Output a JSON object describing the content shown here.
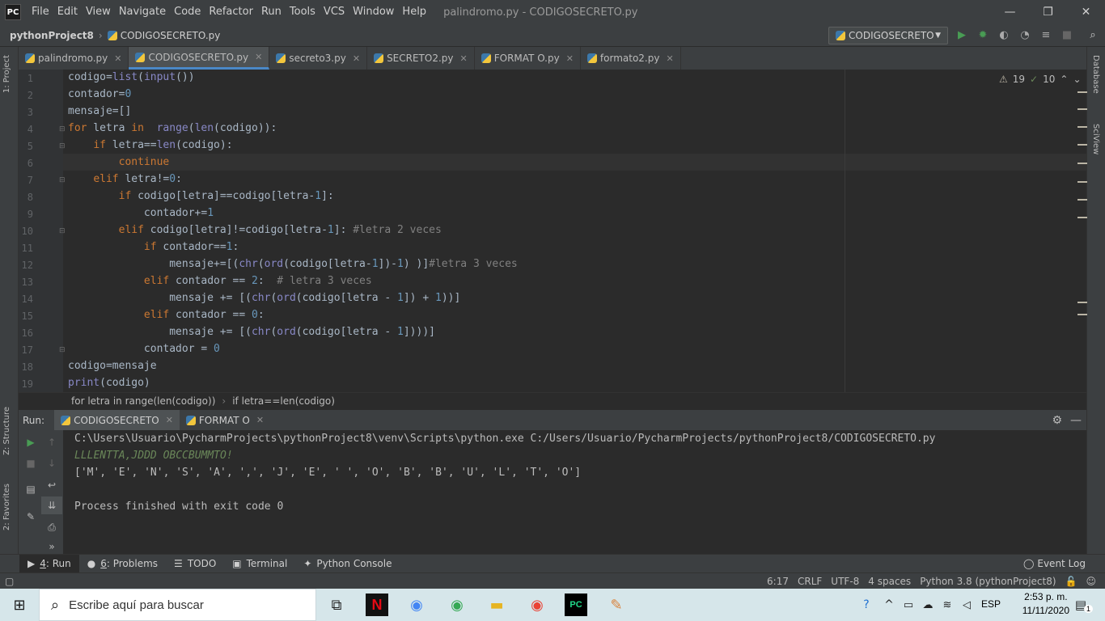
{
  "window": {
    "title": "palindromo.py - CODIGOSECRETO.py",
    "min": "—",
    "max": "❐",
    "close": "✕"
  },
  "menu": [
    "File",
    "Edit",
    "View",
    "Navigate",
    "Code",
    "Refactor",
    "Run",
    "Tools",
    "VCS",
    "Window",
    "Help"
  ],
  "nav": {
    "project": "pythonProject8",
    "file": "CODIGOSECRETO.py",
    "run_config": "CODIGOSECRETO"
  },
  "tabs": [
    "palindromo.py",
    "CODIGOSECRETO.py",
    "secreto3.py",
    "SECRETO2.py",
    "FORMAT O.py",
    "formato2.py"
  ],
  "active_tab": 1,
  "left_tools": {
    "project": "1: Project",
    "structure": "Z: Structure",
    "favorites": "2: Favorites"
  },
  "right_tools": {
    "database": "Database",
    "sciview": "SciView"
  },
  "inspections": {
    "warnings": "19",
    "weak": "10"
  },
  "code_lines": [
    "codigo=list(input())",
    "contador=0",
    "mensaje=[]",
    "for letra in  range(len(codigo)):",
    "    if letra==len(codigo):",
    "        continue",
    "    elif letra!=0:",
    "        if codigo[letra]==codigo[letra-1]:",
    "            contador+=1",
    "        elif codigo[letra]!=codigo[letra-1]: #letra 2 veces",
    "            if contador==1:",
    "                mensaje+=[(chr(ord(codigo[letra-1])-1) )]#letra 3 veces",
    "            elif contador == 2:  # letra 3 veces",
    "                mensaje += [(chr(ord(codigo[letra - 1]) + 1))]",
    "            elif contador == 0:",
    "                mensaje += [(chr(ord(codigo[letra - 1])))]",
    "            contador = 0",
    "codigo=mensaje",
    "print(codigo)"
  ],
  "breadcrumb": [
    "for letra in range(len(codigo))",
    "if letra==len(codigo)"
  ],
  "run": {
    "label": "Run:",
    "tabs": [
      "CODIGOSECRETO",
      "FORMAT O"
    ],
    "command": "C:\\Users\\Usuario\\PycharmProjects\\pythonProject8\\venv\\Scripts\\python.exe C:/Users/Usuario/PycharmProjects/pythonProject8/CODIGOSECRETO.py",
    "input": "LLLENTTA,JDDD OBCCBUMMTO!",
    "output": "['M', 'E', 'N', 'S', 'A', ',', 'J', 'E', ' ', 'O', 'B', 'B', 'U', 'L', 'T', 'O']",
    "exit": "Process finished with exit code 0"
  },
  "bottom_tabs": [
    {
      "num": "4",
      "label": ": Run"
    },
    {
      "num": "6",
      "label": ": Problems"
    },
    {
      "num": "",
      "label": "TODO"
    },
    {
      "num": "",
      "label": "Terminal"
    },
    {
      "num": "",
      "label": "Python Console"
    }
  ],
  "event_log": "Event Log",
  "status": {
    "pos": "6:17",
    "eol": "CRLF",
    "enc": "UTF-8",
    "indent": "4 spaces",
    "interp": "Python 3.8 (pythonProject8)"
  },
  "taskbar": {
    "search_placeholder": "Escribe aquí para buscar",
    "lang": "ESP",
    "time": "2:53 p. m.",
    "date": "11/11/2020",
    "notif": "1"
  },
  "colors": {
    "accent": "#4a88c7",
    "keyword": "#cc7832",
    "number": "#6897bb",
    "input_green": "#6a8759"
  }
}
